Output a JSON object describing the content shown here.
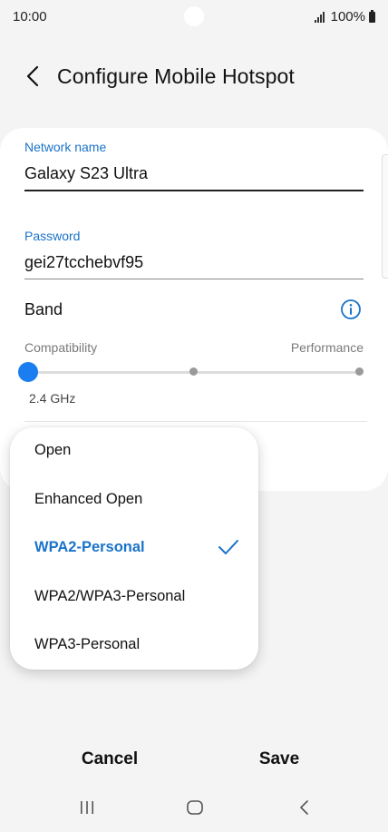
{
  "status_bar": {
    "time": "10:00",
    "battery": "100%"
  },
  "header": {
    "title": "Configure Mobile Hotspot"
  },
  "form": {
    "network_name": {
      "label": "Network name",
      "value": "Galaxy S23 Ultra"
    },
    "password": {
      "label": "Password",
      "value": "gei27tcchebvf95"
    },
    "band": {
      "label": "Band",
      "min_label": "Compatibility",
      "max_label": "Performance",
      "value": "2.4 GHz",
      "level": 0
    }
  },
  "security_menu": {
    "items": [
      {
        "label": "Open",
        "selected": false
      },
      {
        "label": "Enhanced Open",
        "selected": false
      },
      {
        "label": "WPA2-Personal",
        "selected": true
      },
      {
        "label": "WPA2/WPA3-Personal",
        "selected": false
      },
      {
        "label": "WPA3-Personal",
        "selected": false
      }
    ]
  },
  "actions": {
    "cancel": "Cancel",
    "save": "Save"
  },
  "colors": {
    "accent": "#1a73c9",
    "slider_thumb": "#1a7df0",
    "background": "#f4f4f4"
  },
  "icons": {
    "back": "chevron-left-icon",
    "info": "info-icon",
    "check": "check-icon",
    "nav_recents": "recents-icon",
    "nav_home": "home-icon",
    "nav_back": "back-icon"
  }
}
